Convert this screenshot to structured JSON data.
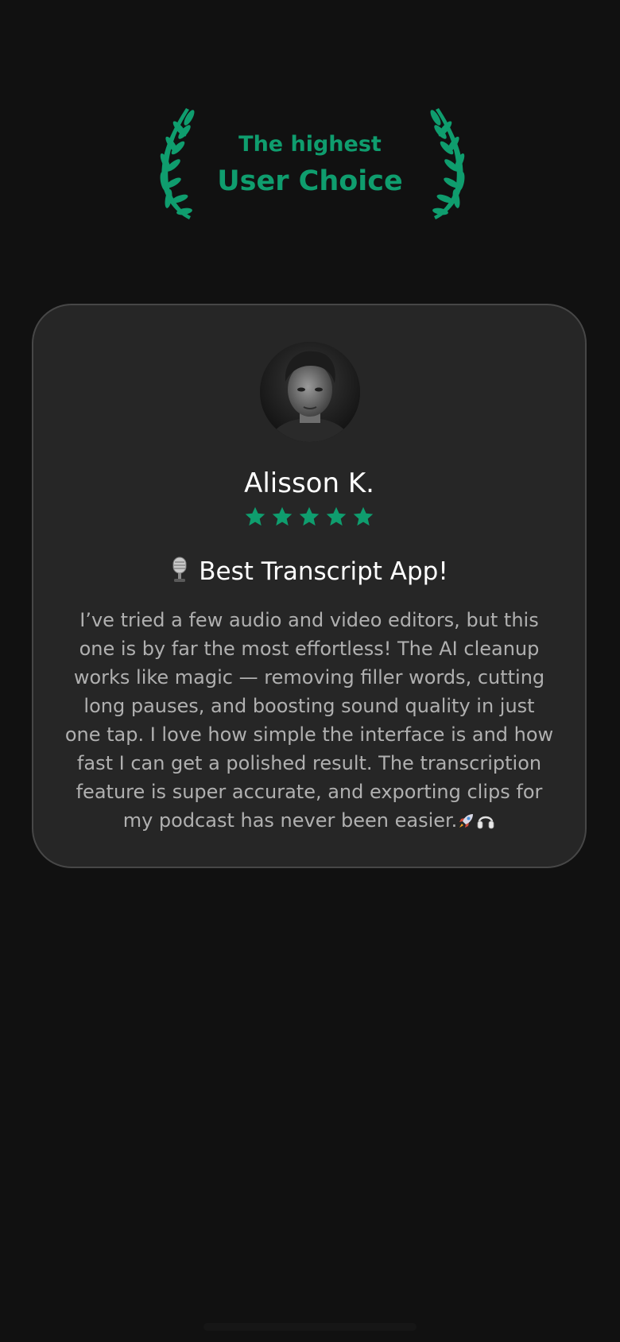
{
  "award": {
    "line1": "The highest",
    "line2": "User Choice",
    "icon": "laurel-wreath-icon",
    "color": "#0f9d6e"
  },
  "review": {
    "reviewer_name": "Alisson K.",
    "rating": 5,
    "rating_max": 5,
    "title_icon": "microphone-icon",
    "title": "Best Transcript App!",
    "body": "I’ve tried a few audio and video editors, but this one is by far the most effortless! The AI cleanup works like magic — removing filler words, cutting long pauses, and boosting sound quality in just one tap. I love how simple the interface is and how fast I can get a polished result. The transcription feature is super accurate, and exporting clips for my podcast has never been easier.",
    "trailing_icons": [
      "rocket-icon",
      "headphones-icon"
    ]
  },
  "colors": {
    "background": "#111111",
    "card": "#262626",
    "card_border": "#474747",
    "accent": "#0f9d6e",
    "text_primary": "#ffffff",
    "text_secondary": "#b0b0b0"
  }
}
